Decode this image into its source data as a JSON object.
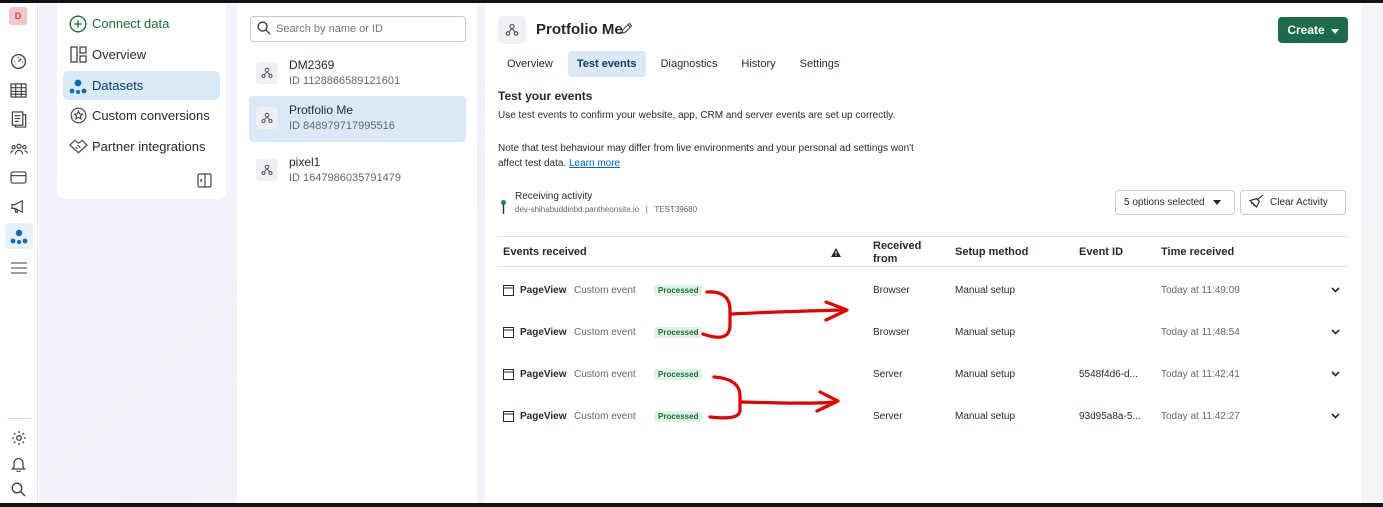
{
  "rail": {
    "avatar": "D"
  },
  "nav": {
    "items": [
      {
        "label": "Connect data"
      },
      {
        "label": "Overview"
      },
      {
        "label": "Datasets"
      },
      {
        "label": "Custom conversions"
      },
      {
        "label": "Partner integrations"
      }
    ]
  },
  "list": {
    "search_placeholder": "Search by name or ID",
    "datasets": [
      {
        "name": "DM2369",
        "id": "ID 1128866589121601"
      },
      {
        "name": "Protfolio Me",
        "id": "ID 848979717995516"
      },
      {
        "name": "pixel1",
        "id": "ID 1647986035791479"
      }
    ]
  },
  "main": {
    "title": "Protfolio Me",
    "create_label": "Create",
    "tabs": [
      "Overview",
      "Test events",
      "Diagnostics",
      "History",
      "Settings"
    ],
    "heading": "Test your events",
    "desc": "Use test events to confirm your website, app, CRM and server events are set up correctly.",
    "note": "Note that test behaviour may differ from live environments and your personal ad settings won't affect test data.",
    "learn_more": "Learn more",
    "receiving_label": "Receiving activity",
    "receiving_detail": "dev-shihabuddinbd.pantheonsite.io   |   TEST39680",
    "options_label": "5 options selected",
    "clear_label": "Clear Activity",
    "columns": {
      "events": "Events received",
      "from": "Received from",
      "setup": "Setup method",
      "event_id": "Event ID",
      "time": "Time received"
    },
    "rows": [
      {
        "event": "PageView",
        "type": "Custom event",
        "status": "Processed",
        "from": "Browser",
        "setup": "Manual setup",
        "event_id": "",
        "time": "Today at 11:49:09"
      },
      {
        "event": "PageView",
        "type": "Custom event",
        "status": "Processed",
        "from": "Browser",
        "setup": "Manual setup",
        "event_id": "",
        "time": "Today at 11:48:54"
      },
      {
        "event": "PageView",
        "type": "Custom event",
        "status": "Processed",
        "from": "Server",
        "setup": "Manual setup",
        "event_id": "5548f4d6-d...",
        "time": "Today at 11:42:41"
      },
      {
        "event": "PageView",
        "type": "Custom event",
        "status": "Processed",
        "from": "Server",
        "setup": "Manual setup",
        "event_id": "93d95a8a-5...",
        "time": "Today at 11:42:27"
      }
    ]
  },
  "colors": {
    "brand_green": "#1c6b4c",
    "active_bg": "#dbe9f6",
    "link": "#0064e0",
    "annotation": "#e00000"
  }
}
